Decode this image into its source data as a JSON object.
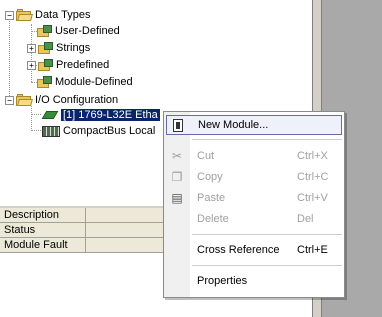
{
  "tree": {
    "data_types": "Data Types",
    "user_defined": "User-Defined",
    "strings": "Strings",
    "predefined": "Predefined",
    "module_defined": "Module-Defined",
    "io_configuration": "I/O Configuration",
    "controller_module": "[1] 1769-L32E Etha",
    "compactbus": "CompactBus Local",
    "expand_minus": "−",
    "expand_plus": "+"
  },
  "properties": {
    "rows": [
      "Description",
      "Status",
      "Module Fault"
    ]
  },
  "context_menu": {
    "new_module": "New Module...",
    "cut": "Cut",
    "cut_shortcut": "Ctrl+X",
    "copy": "Copy",
    "copy_shortcut": "Ctrl+C",
    "paste": "Paste",
    "paste_shortcut": "Ctrl+V",
    "delete": "Delete",
    "delete_shortcut": "Del",
    "cross_reference": "Cross Reference",
    "cross_reference_shortcut": "Ctrl+E",
    "properties": "Properties"
  }
}
